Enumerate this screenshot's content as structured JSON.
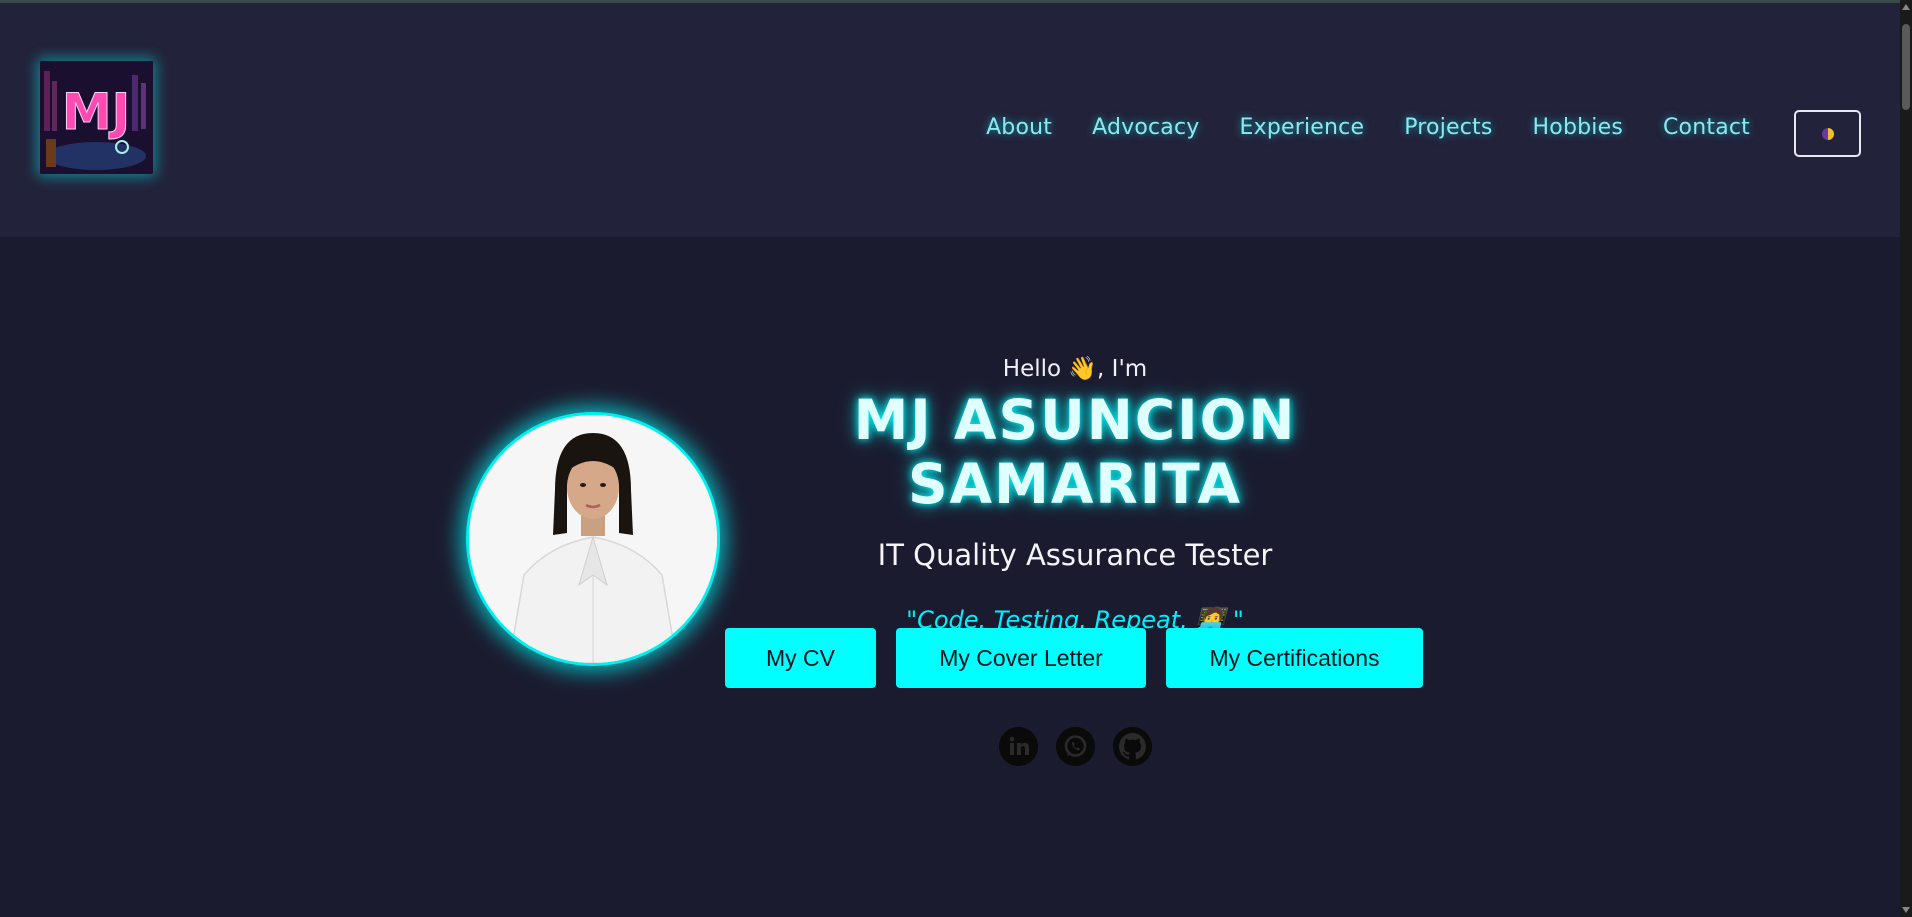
{
  "header": {
    "logo_text": "MJ",
    "nav": [
      {
        "label": "About"
      },
      {
        "label": "Advocacy"
      },
      {
        "label": "Experience"
      },
      {
        "label": "Projects"
      },
      {
        "label": "Hobbies"
      },
      {
        "label": "Contact"
      }
    ],
    "theme_toggle_icon": "half-moon-icon"
  },
  "hero": {
    "greeting": "Hello 👋, I'm",
    "name": "MJ ASUNCION SAMARITA",
    "role": "IT Quality Assurance Tester",
    "quote": "\"Code. Testing. Repeat. 🧑‍💻 \"",
    "buttons": {
      "cv": "My CV",
      "cover_letter": "My Cover Letter",
      "certifications": "My Certifications"
    },
    "socials": [
      "linkedin-icon",
      "whatsapp-icon",
      "github-icon"
    ]
  },
  "colors": {
    "accent": "#00ffff",
    "background": "#1b1b2f",
    "header_bg": "#22223a",
    "nav_text": "#8ee8f0"
  }
}
